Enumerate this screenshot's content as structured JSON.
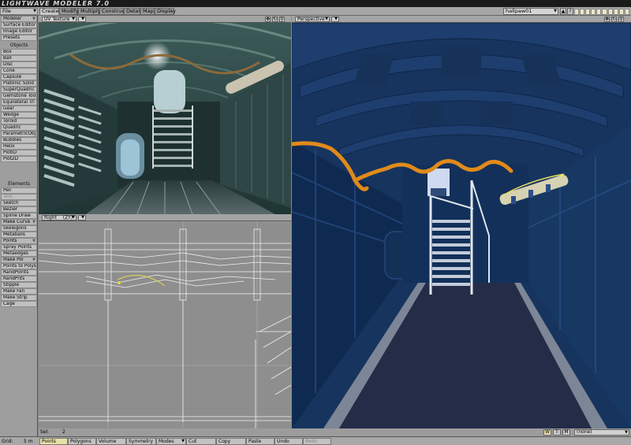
{
  "app": {
    "title": "LIGHTWAVE MODELER 7.0"
  },
  "top_left_menu": {
    "file": "File",
    "modeler": "Modeler"
  },
  "tabs": [
    "Create",
    "Modify",
    "Multiply",
    "Construct",
    "Detail",
    "Map",
    "Display"
  ],
  "active_tab": "Create",
  "layer": {
    "name": "hallpaw01",
    "buttons": [
      "▲",
      "?"
    ]
  },
  "sidebar": {
    "top_items": [
      "Surface Editor",
      "Image Editor",
      "Presets"
    ],
    "objects_header": "Objects",
    "objects": [
      "Box",
      "Ball",
      "Disc",
      "Cone",
      "Capsule",
      "Platonic Solid",
      "SuperQuadric",
      "Gemstone Tool",
      "Equilateral Tri",
      "Gear",
      "Wedge",
      "Toroid",
      "Quadric",
      "ParametricObj",
      "Bubbles",
      "Helix",
      "PlotID",
      "Plot2D"
    ],
    "elements_header": "Elements",
    "elements": [
      "Pen",
      "Text",
      "Sketch",
      "Bezier",
      "Spline Draw",
      "Make Curve",
      "Skelegons",
      "Metaballs",
      "Points",
      "Spray Points",
      "Metaedges",
      "Make Pol",
      "Points to Polys",
      "RandPoints",
      "RandPnts",
      "Stipple",
      "Make Fan",
      "Make Strip",
      "Cage"
    ]
  },
  "viewports": {
    "top_left": {
      "label": "UV Texture"
    },
    "bottom_left": {
      "label": "Right",
      "axes": "(ZY)"
    },
    "right": {
      "label": "Perspective"
    }
  },
  "selection": {
    "label": "Sel:",
    "count": "2",
    "buttons": [
      "W",
      "T",
      "M"
    ],
    "surface": "(none)"
  },
  "bottom_bar": {
    "grid_label": "Grid:",
    "grid_value": "5 m",
    "modes": [
      "Points",
      "Polygons",
      "Volume",
      "Symmetry",
      "Modes",
      "Cut",
      "Copy",
      "Paste",
      "Undo",
      "Redo"
    ],
    "active_mode": "Points"
  },
  "colors": {
    "accent_active": "#e8e0a8",
    "perspective_bg": "#17345e",
    "rope_orange": "#e08a1a"
  }
}
